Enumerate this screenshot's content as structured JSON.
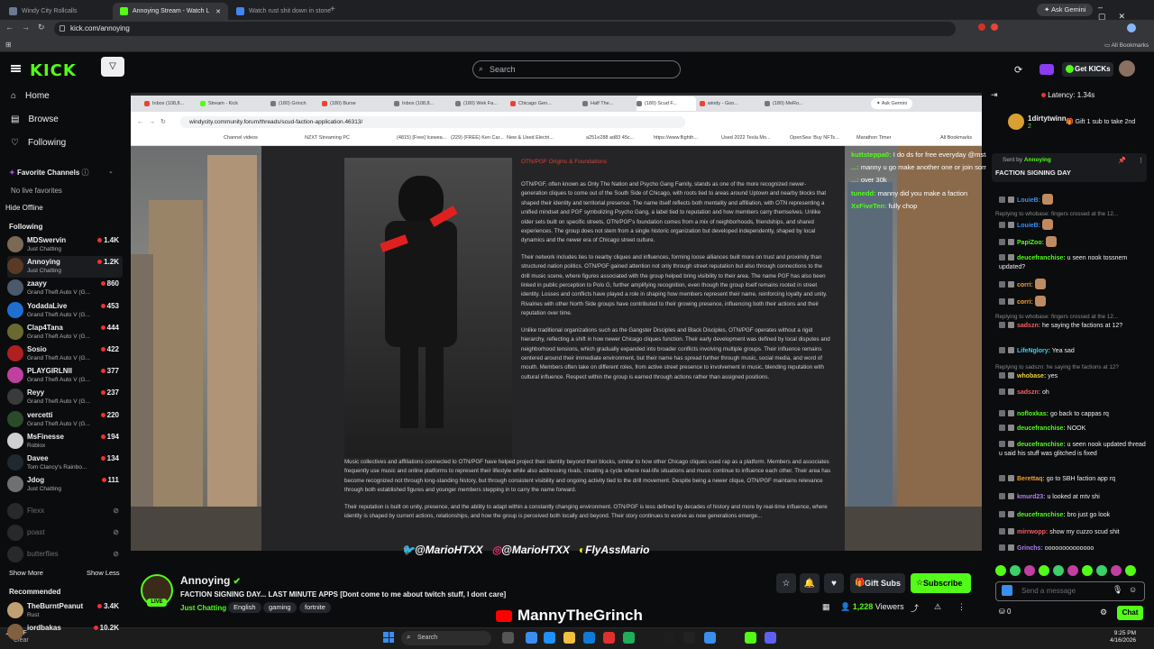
{
  "browser": {
    "tabs": [
      {
        "label": "Windy City Rollcalls",
        "active": false,
        "color": "#6b7a8f"
      },
      {
        "label": "Annoying Stream - Watch L",
        "active": true,
        "color": "#53fc18"
      },
      {
        "label": "Watch rust shit down in stone",
        "active": false,
        "color": "#4285f4"
      }
    ],
    "url": "kick.com/annoying",
    "ask_gemini": "Ask Gemini",
    "all_bookmarks": "All Bookmarks"
  },
  "header": {
    "logo": "KICK",
    "search_placeholder": "Search",
    "get_kicks": "Get KICKs"
  },
  "sidebar": {
    "nav": [
      {
        "label": "Home",
        "icon": "home-icon"
      },
      {
        "label": "Browse",
        "icon": "browse-icon"
      },
      {
        "label": "Following",
        "icon": "heart-icon"
      }
    ],
    "favorite_channels": "Favorite Channels",
    "no_live_favorites": "No live favorites",
    "hide_offline": "Hide Offline",
    "following_title": "Following",
    "following": [
      {
        "name": "MDSwervin",
        "game": "Just Chatting",
        "viewers": "1.4K",
        "color": "#7a6a55"
      },
      {
        "name": "Annoying",
        "game": "Just Chatting",
        "viewers": "1.2K",
        "color": "#5a3a22"
      },
      {
        "name": "zaayy",
        "game": "Grand Theft Auto V (G...",
        "viewers": "860",
        "color": "#4a5a6a"
      },
      {
        "name": "YodadaLive",
        "game": "Grand Theft Auto V (G...",
        "viewers": "453",
        "color": "#1f6fd1"
      },
      {
        "name": "Clap4Tana",
        "game": "Grand Theft Auto V (G...",
        "viewers": "444",
        "color": "#6a6a30"
      },
      {
        "name": "Sosio",
        "game": "Grand Theft Auto V (G...",
        "viewers": "422",
        "color": "#b02020"
      },
      {
        "name": "PLAYGIRLNII",
        "game": "Grand Theft Auto V (G...",
        "viewers": "377",
        "color": "#c040a0"
      },
      {
        "name": "Reyy",
        "game": "Grand Theft Auto V (G...",
        "viewers": "237",
        "color": "#3a3a3a"
      },
      {
        "name": "vercetti",
        "game": "Grand Theft Auto V (G...",
        "viewers": "220",
        "color": "#2a4a2a"
      },
      {
        "name": "MsFinesse",
        "game": "Roblox",
        "viewers": "194",
        "color": "#d0d0d0"
      },
      {
        "name": "Davee",
        "game": "Tom Clancy's Rainbo...",
        "viewers": "134",
        "color": "#202830"
      },
      {
        "name": "Jdog",
        "game": "Just Chatting",
        "viewers": "111",
        "color": "#707070"
      }
    ],
    "offline": [
      "Flexx",
      "poast",
      "butterflies"
    ],
    "show_more": "Show More",
    "show_less": "Show Less",
    "recommended_title": "Recommended",
    "recommended": [
      {
        "name": "TheBurntPeanut",
        "game": "Rust",
        "viewers": "3.4K",
        "color": "#c0a070"
      },
      {
        "name": "iordbakas",
        "game": "",
        "viewers": "10.2K",
        "color": "#806040"
      }
    ]
  },
  "video": {
    "inner_tabs": [
      "Inbox (108,8...",
      "Stream - Kick",
      "(180) Grinch",
      "(180) Burse",
      "Inbox (108,8...",
      "(180) Wek Fa...",
      "Chicago Gen...",
      "Half The...",
      "(180) Scud F...",
      "windy - Goo...",
      "(180) MeRo..."
    ],
    "inner_ask_gemini": "Ask Gemini",
    "inner_url": "windycity.community.forum/threads/scud-faction-application.46313/",
    "inner_bookmarks": [
      "Channel videos",
      "NZXT Streaming PC",
      "(4815) [Free] Icewea...",
      "(229) (FREE) Ken Car...",
      "New & Used Electri...",
      "a251e288 ad83 45c...",
      "https://www.flighth...",
      "Used 2022 Tesla Mo...",
      "OpenSea: Buy NFTs...",
      "Marathon Timer",
      "All Bookmarks"
    ],
    "article_heading": "OTN/PGF  Origins & Foundations",
    "article_paragraphs": [
      "OTN/PGF, often known as Only The Nation and Psycho Gang Family, stands as one of the more recognized newer-generation cliques to come out of the South Side of Chicago, with roots tied to areas around Uptown and nearby blocks that shaped their identity and territorial presence. The name itself reflects both mentality and affiliation, with OTN representing a unified mindset and PGF symbolizing Psycho Gang, a label tied to reputation and how members carry themselves. Unlike older sets built on specific streets, OTN/PGF's foundation comes from a mix of neighborhoods, friendships, and shared experiences. The group does not stem from a single historic organization but developed independently, shaped by local dynamics and the newer era of Chicago street culture.",
      "Their network includes ties to nearby cliques and influences, forming loose alliances built more on trust and proximity than structured nation politics. OTN/PGF gained attention not only through street reputation but also through connections to the drill music scene, where figures associated with the group helped bring visibility to their area. The name PGF has also been linked in public perception to Polo G, further amplifying recognition, even though the group itself remains rooted in street identity. Losses and conflicts have played a role in shaping how members represent their name, reinforcing loyalty and unity. Rivalries with other North Side groups have contributed to their growing presence, influencing both their actions and their reputation over time.",
      "Unlike traditional organizations such as the Gangster Disciples and Black Disciples, OTN/PGF operates without a rigid hierarchy, reflecting a shift in how newer Chicago cliques function. Their early development was defined by local disputes and neighborhood tensions, which gradually expanded into broader conflicts involving multiple groups. Their influence remains centered around their immediate environment, but their name has spread further through music, social media, and word of mouth. Members often take on different roles, from active street presence to involvement in music, blending reputation with cultural influence. Respect within the group is earned through actions rather than assigned positions."
    ],
    "article_wide": [
      "Music collectives and affiliations connected to OTN/PGF have helped project their identity beyond their blocks, similar to how other Chicago cliques used rap as a platform. Members and associates frequently use music and online platforms to represent their lifestyle while also addressing rivals, creating a cycle where real-life situations and music continue to influence each other. Their area has become recognized not through long-standing history, but through consistent visibility and ongoing activity tied to the drill movement. Despite being a newer clique, OTN/PGF maintains relevance through both established figures and younger members stepping in to carry the name forward.",
      "Their reputation is built on unity, presence, and the ability to adapt within a constantly changing environment. OTN/PGF is less defined by decades of history and more by real-time influence, where identity is shaped by current actions, relationships, and how the group is perceived both locally and beyond. Their story continues to evolve as new generations emerge..."
    ],
    "overlay_chat": [
      {
        "user": "kuttsteppa0:",
        "text": "I do ds for free everyday @mstadyyy"
      },
      {
        "user": "...:",
        "text": "manny u go make another one or join some"
      },
      {
        "user": "...:",
        "text": "over 30k"
      },
      {
        "user": "tunedd:",
        "text": "manny did you make a faction"
      },
      {
        "user": "XxFiveTen:",
        "text": "fully chop"
      }
    ],
    "socials": [
      "@MarioHTXX",
      "@MarioHTXX",
      "FlyAssMario"
    ],
    "bottom_brand": "MannyTheGrinch"
  },
  "stream": {
    "streamer": "Annoying",
    "live_badge": "LIVE",
    "title": "FACTION SIGNING DAY... LAST MINUTE APPS  [Dont come to me about twitch stuff, I dont care]",
    "category": "Just Chatting",
    "tags": [
      "English",
      "gaming",
      "fortnite"
    ],
    "gift_subs": "Gift Subs",
    "subscribe": "Subscribe",
    "viewers": "1,228",
    "viewers_label": "Viewers"
  },
  "chat": {
    "latency": "Latency: 1.34s",
    "pinned_user": "1dirtytwinn",
    "pinned_count": "2",
    "pinned_gift": "Gift 1 sub to take 2nd",
    "pinned_sent_by": "Sent by",
    "pinned_author": "Annoying",
    "pinned_msg": "FACTION SIGNING DAY",
    "messages": [
      {
        "reply": "",
        "user": "LouieB:",
        "text": "",
        "color": "#3b8ef0"
      },
      {
        "reply": "Replying to whobase: fingers crossed at the 12...",
        "user": "LouieB:",
        "text": "",
        "color": "#3b8ef0"
      },
      {
        "reply": "",
        "user": "PapiZoo:",
        "text": "",
        "color": "#53fc18"
      },
      {
        "reply": "",
        "user": "deucefranchise:",
        "text": "u seen nook tossnem updated?",
        "color": "#53fc18"
      },
      {
        "reply": "",
        "user": "corri:",
        "text": "",
        "color": "#f0a030"
      },
      {
        "reply": "",
        "user": "corri:",
        "text": "",
        "color": "#f0a030"
      },
      {
        "reply": "Replying to whobase: fingers crossed at the 12...",
        "user": "sadszn:",
        "text": "he saying the factions at 12?",
        "color": "#f06060"
      },
      {
        "reply": "",
        "user": "LifeNglory:",
        "text": "Yea sad",
        "color": "#3bd0f0"
      },
      {
        "reply": "Replying to sadszn: he saying the factions at 12?",
        "user": "whobase:",
        "text": "yes",
        "color": "#f0d030"
      },
      {
        "reply": "",
        "user": "sadszn:",
        "text": "oh",
        "color": "#f06060"
      },
      {
        "reply": "",
        "user": "nofloxkas:",
        "text": "go back to cappas rq",
        "color": "#53fc18"
      },
      {
        "reply": "",
        "user": "deucefranchise:",
        "text": "NOOK",
        "color": "#53fc18"
      },
      {
        "reply": "",
        "user": "deucefranchise:",
        "text": "u seen nook updated thread u said his stuff was glitched is fixed",
        "color": "#53fc18"
      },
      {
        "reply": "",
        "user": "Berettaq:",
        "text": "go to SBH faction app rq",
        "color": "#f0a030"
      },
      {
        "reply": "",
        "user": "kmurd23:",
        "text": "u looked at mtv shi",
        "color": "#b080f0"
      },
      {
        "reply": "",
        "user": "deucefranchise:",
        "text": "bro just go look",
        "color": "#53fc18"
      },
      {
        "reply": "",
        "user": "mirrwopp:",
        "text": "show my cuzzo scud shit",
        "color": "#f06060"
      },
      {
        "reply": "",
        "user": "Grinchs:",
        "text": "oooooooooooooo",
        "color": "#b080f0"
      }
    ],
    "input_placeholder": "Send a message",
    "points": "0",
    "chat_button": "Chat"
  },
  "taskbar": {
    "weather_temp": "75°F",
    "weather_desc": "Clear",
    "search": "Search",
    "time": "9:25 PM",
    "date": "4/16/2026"
  }
}
